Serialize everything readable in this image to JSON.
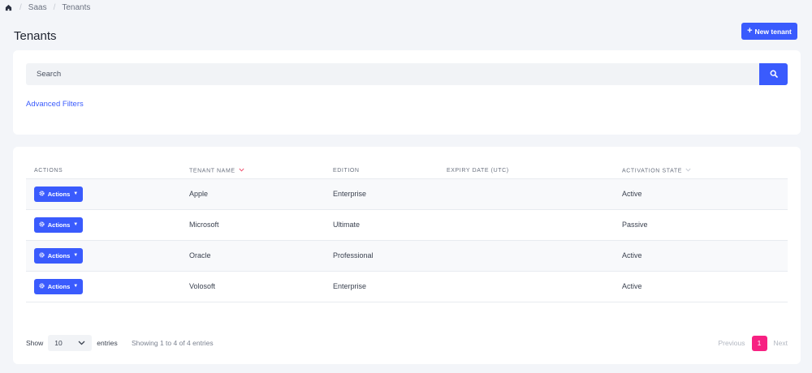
{
  "breadcrumb": {
    "items": [
      "Saas",
      "Tenants"
    ]
  },
  "page": {
    "title": "Tenants",
    "new_button_label": "New tenant"
  },
  "search": {
    "placeholder": "Search",
    "advanced_filters_label": "Advanced Filters"
  },
  "table": {
    "columns": {
      "actions": "ACTIONS",
      "tenant_name": "TENANT NAME",
      "edition": "EDITION",
      "expiry_date": "EXPIRY DATE (UTC)",
      "activation_state": "ACTIVATION STATE"
    },
    "action_label": "Actions",
    "rows": [
      {
        "name": "Apple",
        "edition": "Enterprise",
        "expiry": "",
        "state": "Active"
      },
      {
        "name": "Microsoft",
        "edition": "Ultimate",
        "expiry": "",
        "state": "Passive"
      },
      {
        "name": "Oracle",
        "edition": "Professional",
        "expiry": "",
        "state": "Active"
      },
      {
        "name": "Volosoft",
        "edition": "Enterprise",
        "expiry": "",
        "state": "Active"
      }
    ]
  },
  "pagination": {
    "show_label": "Show",
    "page_size": "10",
    "entries_label": "entries",
    "info": "Showing 1 to 4 of 4 entries",
    "previous": "Previous",
    "current_page": "1",
    "next": "Next"
  },
  "colors": {
    "primary": "#3a5bfd",
    "active_page": "#f72182",
    "sort_active": "#f0506e"
  }
}
